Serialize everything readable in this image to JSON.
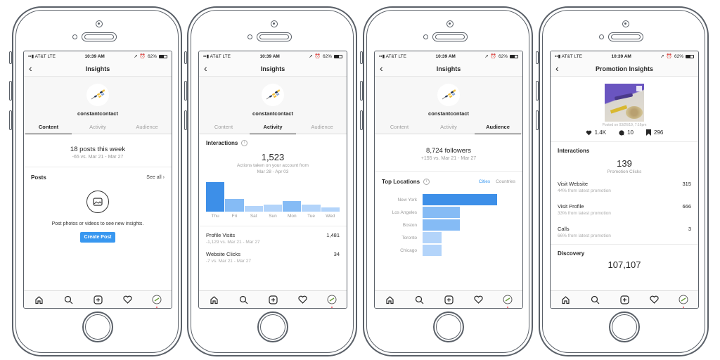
{
  "status_bar": {
    "carrier": "AT&T",
    "network": "LTE",
    "time": "10:39 AM",
    "battery": "62%"
  },
  "phones": [
    {
      "nav_title": "Insights",
      "username": "constantcontact",
      "tabs": [
        "Content",
        "Activity",
        "Audience"
      ],
      "active_tab": "Content",
      "summary": {
        "headline": "18 posts this week",
        "comparison": "-65 vs. Mar 21 - Mar 27"
      },
      "posts": {
        "title": "Posts",
        "see_all": "See all",
        "empty_text": "Post photos or videos to see new insights.",
        "create_button": "Create Post"
      }
    },
    {
      "nav_title": "Insights",
      "username": "constantcontact",
      "tabs": [
        "Content",
        "Activity",
        "Audience"
      ],
      "active_tab": "Activity",
      "interactions": {
        "title": "Interactions",
        "total": "1,523",
        "caption_line1": "Actions taken on your account from",
        "caption_line2": "Mar 28 - Apr 03"
      },
      "metrics": [
        {
          "name": "Profile Visits",
          "value": "1,481",
          "comparison": "-1,129 vs. Mar 21 - Mar 27"
        },
        {
          "name": "Website Clicks",
          "value": "34",
          "comparison": "-7 vs. Mar 21 - Mar 27"
        }
      ]
    },
    {
      "nav_title": "Insights",
      "username": "constantcontact",
      "tabs": [
        "Content",
        "Activity",
        "Audience"
      ],
      "active_tab": "Audience",
      "summary": {
        "headline": "8,724 followers",
        "comparison": "+155 vs. Mar 21 - Mar 27"
      },
      "locations": {
        "title": "Top Locations",
        "toggle_active": "Cities",
        "toggle_inactive": "Countries"
      }
    },
    {
      "nav_title": "Promotion Insights",
      "posted": "Posted on 03/26/19, 7:16pm",
      "stats": {
        "likes": "1.4K",
        "comments": "10",
        "saves": "296"
      },
      "interactions": {
        "title": "Interactions",
        "total": "139",
        "caption": "Promotion Clicks"
      },
      "metrics": [
        {
          "name": "Visit Website",
          "value": "315",
          "sub": "44% from latest promotion"
        },
        {
          "name": "Visit Profile",
          "value": "666",
          "sub": "33% from latest promotion"
        },
        {
          "name": "Calls",
          "value": "3",
          "sub": "66% from latest promotion"
        }
      ],
      "discovery": {
        "title": "Discovery",
        "partial_value": "107,107"
      }
    }
  ],
  "tab_bar_icons": [
    "home-icon",
    "search-icon",
    "add-post-icon",
    "heart-icon",
    "profile-avatar-icon"
  ],
  "colors": {
    "accent": "#3897f0",
    "bar_primary": "#3d8fe8",
    "bar_mid": "#85bbf5",
    "bar_light": "#b3d4fa",
    "notification_dot": "#ed4956"
  },
  "chart_data": [
    {
      "type": "bar",
      "title": "Interactions",
      "categories": [
        "Thu",
        "Fri",
        "Sat",
        "Sun",
        "Mon",
        "Tue",
        "Wed"
      ],
      "values": [
        100,
        44,
        20,
        25,
        37,
        25,
        15
      ],
      "value_unit": "relative (percent of Thu), no axis shown",
      "highlighted": "Thu"
    },
    {
      "type": "bar",
      "orientation": "horizontal",
      "title": "Top Locations",
      "categories": [
        "New York",
        "Los Angeles",
        "Boston",
        "Toronto",
        "Chicago"
      ],
      "values": [
        100,
        50,
        50,
        25,
        25
      ],
      "value_unit": "relative (percent of New York), no axis shown",
      "highlighted": "New York"
    }
  ]
}
